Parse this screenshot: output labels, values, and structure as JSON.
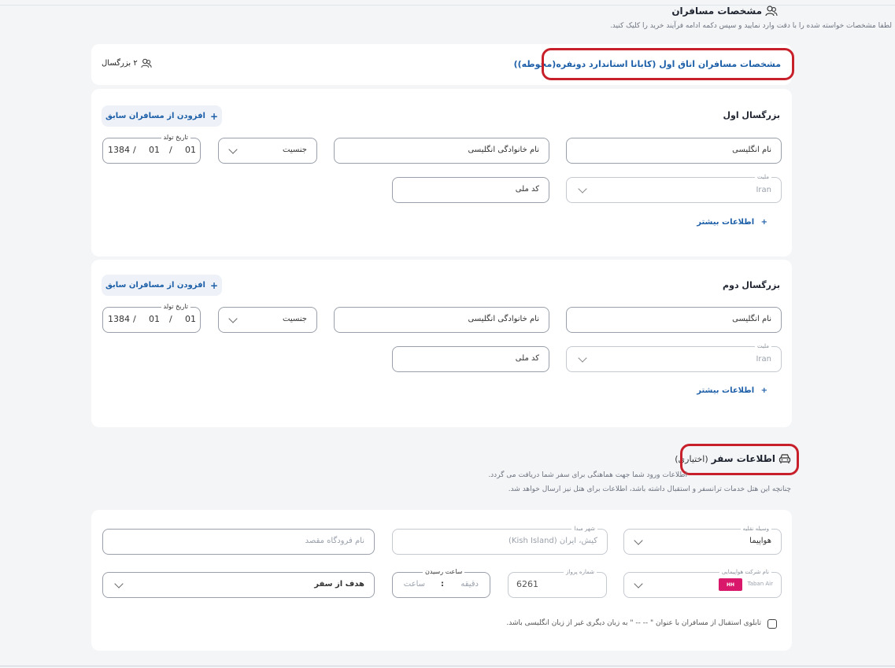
{
  "passengers_section": {
    "title": "مشخصات مسافران",
    "subtitle": "لطفا مشخصات خواسته شده را با دقت وارد نمایید و سپس دکمه ادامه فرآیند خرید را کلیک کنید."
  },
  "room": {
    "title": "مشخصات مسافران اتاق اول (کابانا استاندارد دونفره(محوطه))",
    "adults_count": "۲ بزرگسال"
  },
  "adults": [
    {
      "title": "بزرگسال اول",
      "add_previous": "افزودن از مسافران سابق",
      "birth_label": "تاریخ تولد",
      "birth_year": "1384",
      "birth_month": "01",
      "birth_day": "01",
      "gender_placeholder": "جنسیت",
      "last_name_placeholder": "نام خانوادگی انگلیسی",
      "first_name_placeholder": "نام انگلیسی",
      "national_code_placeholder": "کد ملی",
      "nationality_label": "ملیت",
      "nationality_value": "Iran",
      "more_info": "اطلاعات بیشتر"
    },
    {
      "title": "بزرگسال دوم",
      "add_previous": "افزودن از مسافران سابق",
      "birth_label": "تاریخ تولد",
      "birth_year": "1384",
      "birth_month": "01",
      "birth_day": "01",
      "gender_placeholder": "جنسیت",
      "last_name_placeholder": "نام خانوادگی انگلیسی",
      "first_name_placeholder": "نام انگلیسی",
      "national_code_placeholder": "کد ملی",
      "nationality_label": "ملیت",
      "nationality_value": "Iran",
      "more_info": "اطلاعات بیشتر"
    }
  ],
  "trip_section": {
    "title": "اطلاعات سفر",
    "optional": "(اختیاری)",
    "desc1": "اطلاعات ورود شما جهت هماهنگی برای سفر شما دریافت می گردد.",
    "desc2": "چنانچه این هتل خدمات ترانسفر و استقبال داشته باشد، اطلاعات برای هتل نیز ارسال خواهد شد."
  },
  "trip_form": {
    "vehicle_label": "وسیله نقلیه",
    "vehicle_value": "هواپیما",
    "origin_label": "شهر مبدا",
    "origin_value": "کیش، ایران (Kish Island)",
    "dest_airport_placeholder": "نام فرودگاه مقصد",
    "airline_label": "نام شرکت هواپیمایی",
    "airline_value": "Taban Air",
    "airline_code": "HH",
    "flight_no_label": "شماره پرواز",
    "flight_no_value": "6261",
    "arrival_label": "ساعت رسیدن",
    "arrival_minute": "دقیقه",
    "arrival_sep": ":",
    "arrival_hour": "ساعت",
    "purpose_placeholder": "هدف از سفر",
    "board_text": "تابلوی استقبال از مسافران با عنوان \" -- -- \" به زبان دیگری غیر از زبان انگلیسی باشد."
  },
  "colors": {
    "accent": "#1d5fa8",
    "highlight": "#c8202a",
    "badge": "#d9186b"
  }
}
